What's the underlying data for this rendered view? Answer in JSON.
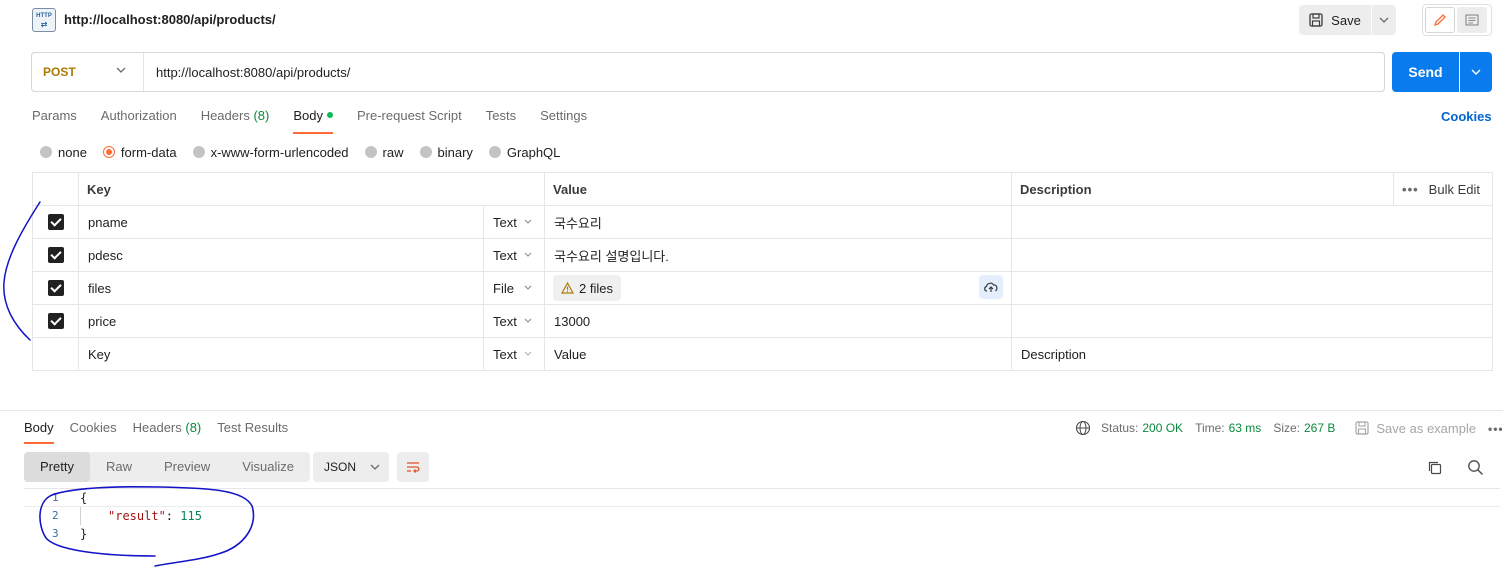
{
  "request": {
    "title": "http://localhost:8080/api/products/",
    "icon": "http-icon",
    "save_label": "Save",
    "method": "POST",
    "url": "http://localhost:8080/api/products/",
    "send_label": "Send"
  },
  "request_tabs": [
    {
      "label": "Params",
      "count": ""
    },
    {
      "label": "Authorization",
      "count": ""
    },
    {
      "label": "Headers",
      "count": "(8)"
    },
    {
      "label": "Body",
      "count": ""
    },
    {
      "label": "Pre-request Script",
      "count": ""
    },
    {
      "label": "Tests",
      "count": ""
    },
    {
      "label": "Settings",
      "count": ""
    }
  ],
  "cookies_label": "Cookies",
  "body_types": [
    "none",
    "form-data",
    "x-www-form-urlencoded",
    "raw",
    "binary",
    "GraphQL"
  ],
  "form_table": {
    "headers": {
      "key": "Key",
      "value": "Value",
      "description": "Description",
      "bulk_edit": "Bulk Edit"
    },
    "rows": [
      {
        "key": "pname",
        "type": "Text",
        "value": "국수요리"
      },
      {
        "key": "pdesc",
        "type": "Text",
        "value": "국수요리 설명입니다."
      },
      {
        "key": "files",
        "type": "File",
        "value": "2 files"
      },
      {
        "key": "price",
        "type": "Text",
        "value": "13000"
      }
    ],
    "empty_row": {
      "key": "Key",
      "type": "Text",
      "value": "Value",
      "description": "Description"
    }
  },
  "response_tabs": [
    {
      "label": "Body",
      "count": ""
    },
    {
      "label": "Cookies",
      "count": ""
    },
    {
      "label": "Headers",
      "count": "(8)"
    },
    {
      "label": "Test Results",
      "count": ""
    }
  ],
  "response_meta": {
    "status_label": "Status:",
    "status_value": "200 OK",
    "time_label": "Time:",
    "time_value": "63 ms",
    "size_label": "Size:",
    "size_value": "267 B",
    "save_example": "Save as example"
  },
  "view_tabs": [
    "Pretty",
    "Raw",
    "Preview",
    "Visualize"
  ],
  "format": "JSON",
  "code": {
    "line_numbers": [
      "1",
      "2",
      "3"
    ],
    "open_brace": "{",
    "key": "\"result\"",
    "colon": ": ",
    "value": "115",
    "close_brace": "}"
  },
  "colors": {
    "accent": "#ff6c37",
    "send": "#097bed",
    "method": "#ad7a03",
    "success": "#0a8a3a",
    "annotation": "#1414c8"
  }
}
